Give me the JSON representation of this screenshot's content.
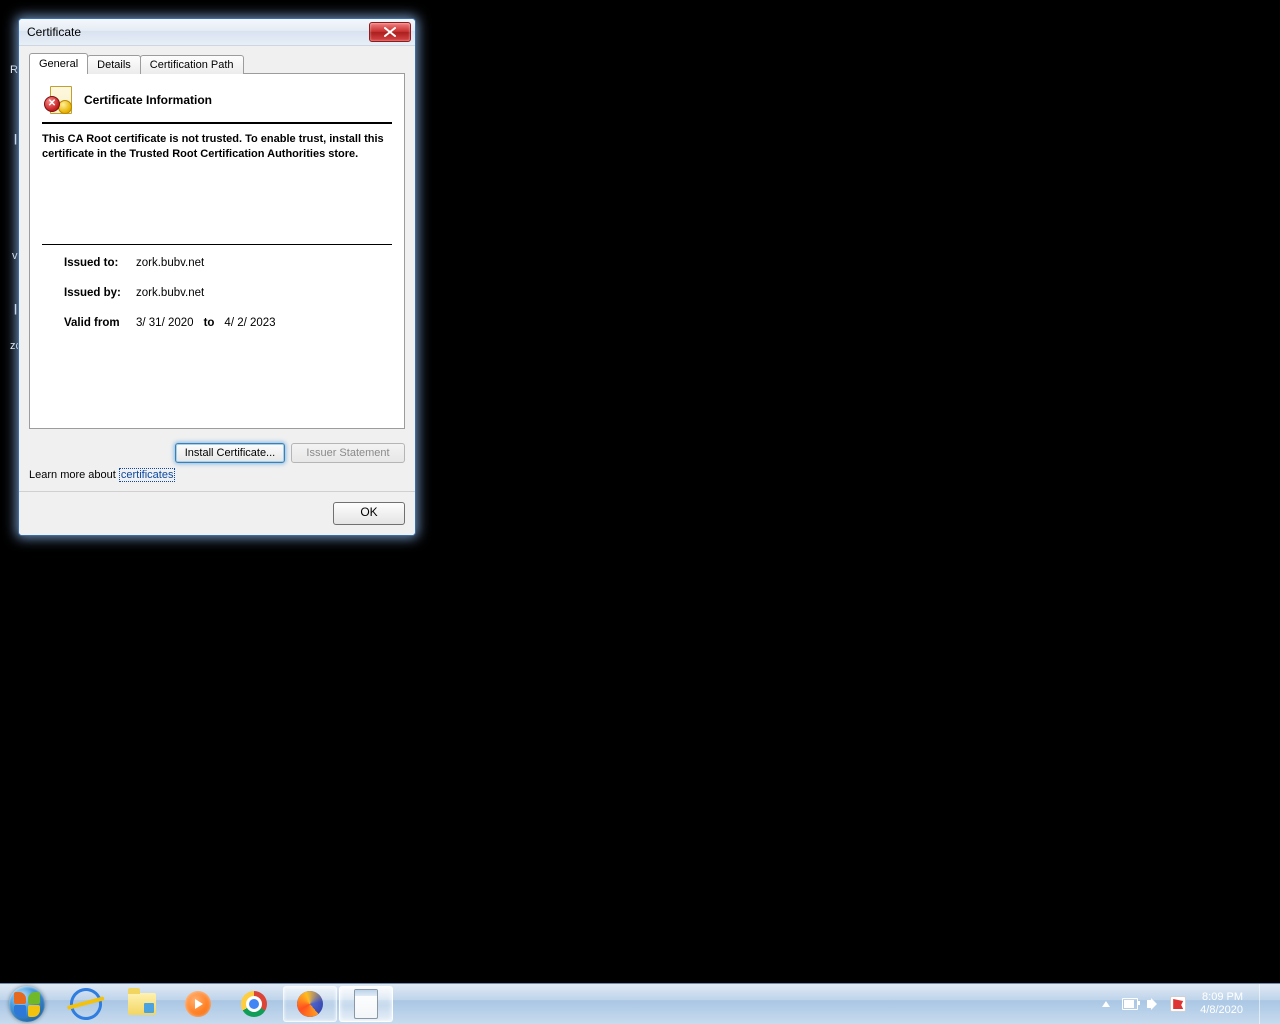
{
  "background_text": {
    "r": "R",
    "bar": "|",
    "v": "v",
    "bar2": "|",
    "zc": "zc"
  },
  "dialog": {
    "title": "Certificate",
    "tabs": {
      "general": "General",
      "details": "Details",
      "certpath": "Certification Path"
    },
    "heading": "Certificate Information",
    "warning": "This CA Root certificate is not trusted. To enable trust, install this certificate in the Trusted Root Certification Authorities store.",
    "issued_to_label": "Issued to:",
    "issued_to_value": "zork.bubv.net",
    "issued_by_label": "Issued by:",
    "issued_by_value": "zork.bubv.net",
    "valid_from_label": "Valid from",
    "valid_from_value": "3/ 31/ 2020",
    "valid_to_word": "to",
    "valid_to_value": "4/ 2/ 2023",
    "install_button": "Install Certificate...",
    "issuer_button": "Issuer Statement",
    "learn_prefix": "Learn more about ",
    "learn_link": "certificates",
    "ok": "OK"
  },
  "taskbar": {
    "time": "8:09 PM",
    "date": "4/8/2020"
  }
}
